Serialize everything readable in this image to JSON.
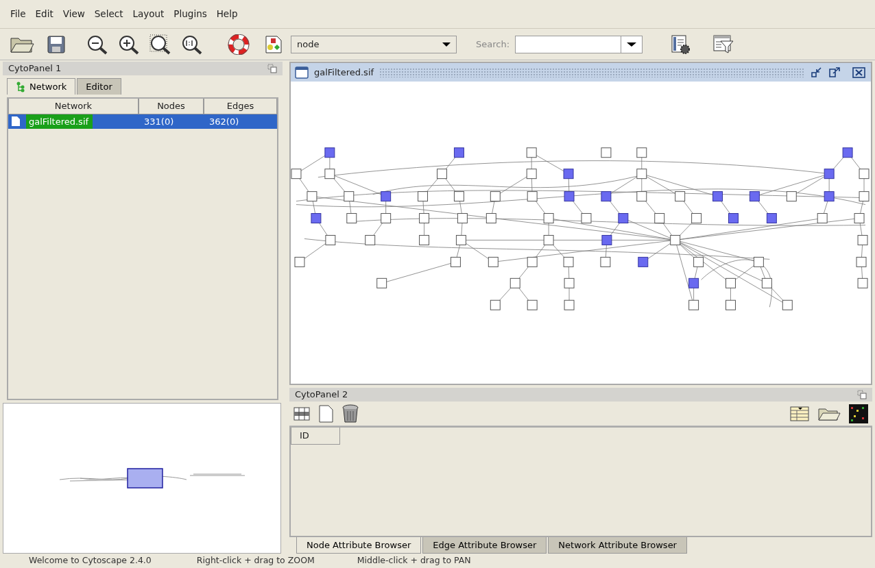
{
  "menu": [
    "File",
    "Edit",
    "View",
    "Select",
    "Layout",
    "Plugins",
    "Help"
  ],
  "toolbar": {
    "type_select": {
      "value": "node"
    },
    "search": {
      "label": "Search:"
    }
  },
  "cytopanel_1": {
    "title": "CytoPanel 1",
    "tabs": [
      {
        "label": "Network",
        "selected": true
      },
      {
        "label": "Editor",
        "selected": false
      }
    ],
    "table": {
      "columns": [
        "Network",
        "Nodes",
        "Edges"
      ],
      "rows": [
        {
          "cells": [
            "galFiltered.sif",
            "331(0)",
            "362(0)"
          ],
          "selected": true
        }
      ]
    }
  },
  "network_view": {
    "title": "galFiltered.sif"
  },
  "cytopanel_2": {
    "title": "CytoPanel 2",
    "table": {
      "columns": [
        "ID"
      ]
    },
    "tabs": [
      {
        "label": "Node Attribute Browser",
        "selected": true
      },
      {
        "label": "Edge Attribute Browser",
        "selected": false
      },
      {
        "label": "Network Attribute Browser",
        "selected": false
      }
    ]
  },
  "status_bar": [
    "Welcome to Cytoscape 2.4.0",
    "Right-click + drag to ZOOM",
    "Middle-click + drag to PAN"
  ]
}
